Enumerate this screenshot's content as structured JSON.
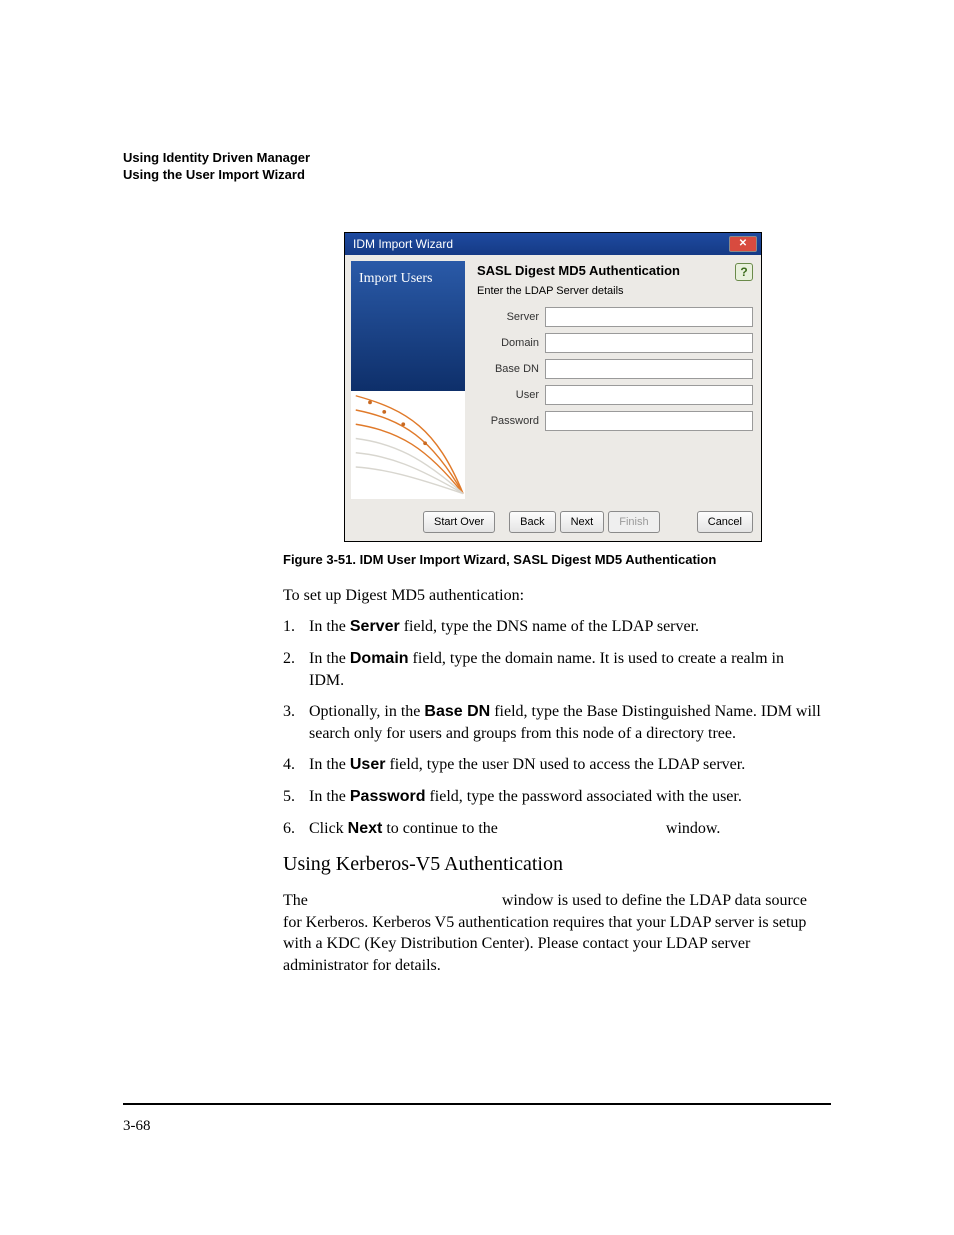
{
  "header": {
    "line1": "Using Identity Driven Manager",
    "line2": "Using the User Import Wizard"
  },
  "dialog": {
    "title": "IDM Import Wizard",
    "close_glyph": "✕",
    "side_title": "Import Users",
    "heading": "SASL Digest MD5 Authentication",
    "help_glyph": "?",
    "subheading": "Enter the LDAP Server details",
    "fields": {
      "server": {
        "label": "Server",
        "value": ""
      },
      "domain": {
        "label": "Domain",
        "value": ""
      },
      "basedn": {
        "label": "Base DN",
        "value": ""
      },
      "user": {
        "label": "User",
        "value": ""
      },
      "password": {
        "label": "Password",
        "value": ""
      }
    },
    "buttons": {
      "start_over": "Start Over",
      "back": "Back",
      "next": "Next",
      "finish": "Finish",
      "cancel": "Cancel"
    }
  },
  "caption": "Figure 3-51. IDM User Import Wizard, SASL Digest MD5 Authentication",
  "intro": "To set up Digest MD5 authentication:",
  "steps": {
    "s1": {
      "n": "1.",
      "pre": "In the ",
      "bold": "Server",
      "post": " field, type the DNS name of the LDAP server."
    },
    "s2": {
      "n": "2.",
      "pre": "In the ",
      "bold": "Domain",
      "post": " field, type the domain name. It is used to create a realm in IDM."
    },
    "s3": {
      "n": "3.",
      "pre": "Optionally, in the ",
      "bold": "Base DN",
      "post": " field, type the Base Distinguished Name. IDM will search only for users and groups from this node of a directory tree."
    },
    "s4": {
      "n": "4.",
      "pre": "In the ",
      "bold": "User",
      "post": " field, type the user DN used to access the LDAP server."
    },
    "s5": {
      "n": "5.",
      "pre": "In the ",
      "bold": "Password",
      "post": " field, type the password associated with the user."
    },
    "s6": {
      "n": "6.",
      "pre": "Click ",
      "bold": "Next",
      "post": " to continue to the ",
      "tail": " window."
    }
  },
  "section_heading": "Using Kerberos-V5 Authentication",
  "kerb_para": {
    "pre": "The ",
    "mid": " window is used to define the LDAP data source for Kerberos. Kerberos V5 authentication requires that your LDAP server is setup with a KDC (Key Distribution Center). Please contact your LDAP server administrator for details."
  },
  "pagenum": "3-68"
}
